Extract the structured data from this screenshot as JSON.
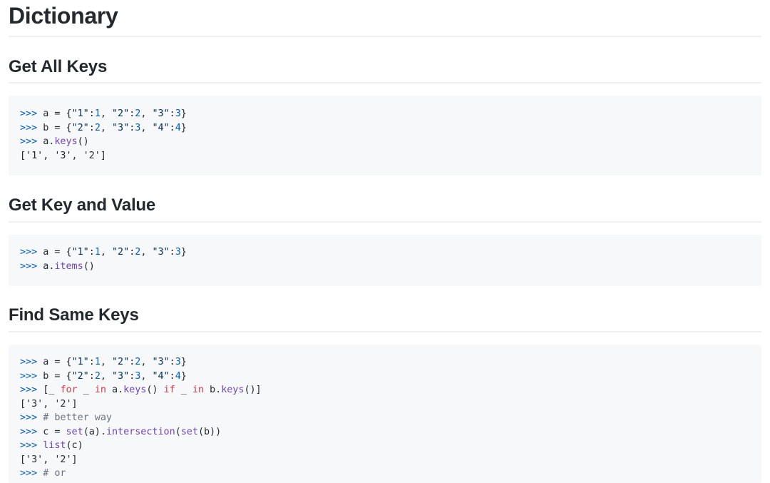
{
  "page_title": "Dictionary",
  "sections": [
    {
      "heading": "Get All Keys",
      "code": [
        [
          {
            "t": ">>> ",
            "c": "prompt"
          },
          {
            "t": "a = {",
            "c": "plain"
          },
          {
            "t": "\"1\"",
            "c": "str"
          },
          {
            "t": ":",
            "c": "plain"
          },
          {
            "t": "1",
            "c": "num"
          },
          {
            "t": ", ",
            "c": "plain"
          },
          {
            "t": "\"2\"",
            "c": "str"
          },
          {
            "t": ":",
            "c": "plain"
          },
          {
            "t": "2",
            "c": "num"
          },
          {
            "t": ", ",
            "c": "plain"
          },
          {
            "t": "\"3\"",
            "c": "str"
          },
          {
            "t": ":",
            "c": "plain"
          },
          {
            "t": "3",
            "c": "num"
          },
          {
            "t": "}",
            "c": "plain"
          }
        ],
        [
          {
            "t": ">>> ",
            "c": "prompt"
          },
          {
            "t": "b = {",
            "c": "plain"
          },
          {
            "t": "\"2\"",
            "c": "str"
          },
          {
            "t": ":",
            "c": "plain"
          },
          {
            "t": "2",
            "c": "num"
          },
          {
            "t": ", ",
            "c": "plain"
          },
          {
            "t": "\"3\"",
            "c": "str"
          },
          {
            "t": ":",
            "c": "plain"
          },
          {
            "t": "3",
            "c": "num"
          },
          {
            "t": ", ",
            "c": "plain"
          },
          {
            "t": "\"4\"",
            "c": "str"
          },
          {
            "t": ":",
            "c": "plain"
          },
          {
            "t": "4",
            "c": "num"
          },
          {
            "t": "}",
            "c": "plain"
          }
        ],
        [
          {
            "t": ">>> ",
            "c": "prompt"
          },
          {
            "t": "a.",
            "c": "plain"
          },
          {
            "t": "keys",
            "c": "fn"
          },
          {
            "t": "()",
            "c": "plain"
          }
        ],
        [
          {
            "t": "['1', '3', '2']",
            "c": "plain"
          }
        ]
      ]
    },
    {
      "heading": "Get Key and Value",
      "code": [
        [
          {
            "t": ">>> ",
            "c": "prompt"
          },
          {
            "t": "a = {",
            "c": "plain"
          },
          {
            "t": "\"1\"",
            "c": "str"
          },
          {
            "t": ":",
            "c": "plain"
          },
          {
            "t": "1",
            "c": "num"
          },
          {
            "t": ", ",
            "c": "plain"
          },
          {
            "t": "\"2\"",
            "c": "str"
          },
          {
            "t": ":",
            "c": "plain"
          },
          {
            "t": "2",
            "c": "num"
          },
          {
            "t": ", ",
            "c": "plain"
          },
          {
            "t": "\"3\"",
            "c": "str"
          },
          {
            "t": ":",
            "c": "plain"
          },
          {
            "t": "3",
            "c": "num"
          },
          {
            "t": "}",
            "c": "plain"
          }
        ],
        [
          {
            "t": ">>> ",
            "c": "prompt"
          },
          {
            "t": "a.",
            "c": "plain"
          },
          {
            "t": "items",
            "c": "fn"
          },
          {
            "t": "()",
            "c": "plain"
          }
        ]
      ]
    },
    {
      "heading": "Find Same Keys",
      "code": [
        [
          {
            "t": ">>> ",
            "c": "prompt"
          },
          {
            "t": "a = {",
            "c": "plain"
          },
          {
            "t": "\"1\"",
            "c": "str"
          },
          {
            "t": ":",
            "c": "plain"
          },
          {
            "t": "1",
            "c": "num"
          },
          {
            "t": ", ",
            "c": "plain"
          },
          {
            "t": "\"2\"",
            "c": "str"
          },
          {
            "t": ":",
            "c": "plain"
          },
          {
            "t": "2",
            "c": "num"
          },
          {
            "t": ", ",
            "c": "plain"
          },
          {
            "t": "\"3\"",
            "c": "str"
          },
          {
            "t": ":",
            "c": "plain"
          },
          {
            "t": "3",
            "c": "num"
          },
          {
            "t": "}",
            "c": "plain"
          }
        ],
        [
          {
            "t": ">>> ",
            "c": "prompt"
          },
          {
            "t": "b = {",
            "c": "plain"
          },
          {
            "t": "\"2\"",
            "c": "str"
          },
          {
            "t": ":",
            "c": "plain"
          },
          {
            "t": "2",
            "c": "num"
          },
          {
            "t": ", ",
            "c": "plain"
          },
          {
            "t": "\"3\"",
            "c": "str"
          },
          {
            "t": ":",
            "c": "plain"
          },
          {
            "t": "3",
            "c": "num"
          },
          {
            "t": ", ",
            "c": "plain"
          },
          {
            "t": "\"4\"",
            "c": "str"
          },
          {
            "t": ":",
            "c": "plain"
          },
          {
            "t": "4",
            "c": "num"
          },
          {
            "t": "}",
            "c": "plain"
          }
        ],
        [
          {
            "t": ">>> ",
            "c": "prompt"
          },
          {
            "t": "[_ ",
            "c": "plain"
          },
          {
            "t": "for",
            "c": "kw"
          },
          {
            "t": " _ ",
            "c": "plain"
          },
          {
            "t": "in",
            "c": "kw"
          },
          {
            "t": " a.",
            "c": "plain"
          },
          {
            "t": "keys",
            "c": "fn"
          },
          {
            "t": "() ",
            "c": "plain"
          },
          {
            "t": "if",
            "c": "kw"
          },
          {
            "t": " _ ",
            "c": "plain"
          },
          {
            "t": "in",
            "c": "kw"
          },
          {
            "t": " b.",
            "c": "plain"
          },
          {
            "t": "keys",
            "c": "fn"
          },
          {
            "t": "()]",
            "c": "plain"
          }
        ],
        [
          {
            "t": "['3', '2']",
            "c": "plain"
          }
        ],
        [
          {
            "t": ">>> ",
            "c": "prompt"
          },
          {
            "t": "# better way",
            "c": "cm"
          }
        ],
        [
          {
            "t": ">>> ",
            "c": "prompt"
          },
          {
            "t": "c = ",
            "c": "plain"
          },
          {
            "t": "set",
            "c": "fn"
          },
          {
            "t": "(a).",
            "c": "plain"
          },
          {
            "t": "intersection",
            "c": "fn"
          },
          {
            "t": "(",
            "c": "plain"
          },
          {
            "t": "set",
            "c": "fn"
          },
          {
            "t": "(b))",
            "c": "plain"
          }
        ],
        [
          {
            "t": ">>> ",
            "c": "prompt"
          },
          {
            "t": "list",
            "c": "fn"
          },
          {
            "t": "(c)",
            "c": "plain"
          }
        ],
        [
          {
            "t": "['3', '2']",
            "c": "plain"
          }
        ],
        [
          {
            "t": ">>> ",
            "c": "prompt"
          },
          {
            "t": "# or",
            "c": "cm"
          }
        ]
      ]
    }
  ]
}
